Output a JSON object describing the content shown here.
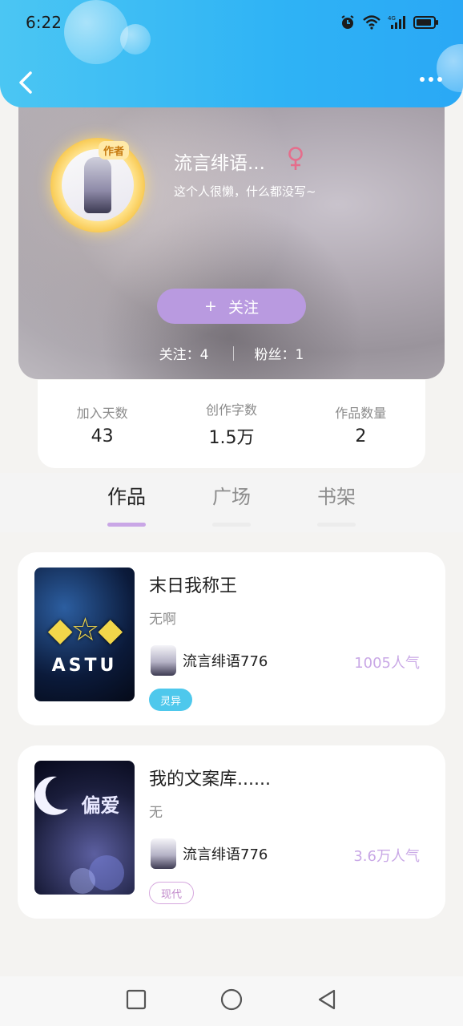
{
  "status_bar": {
    "time": "6:22",
    "network": "4G"
  },
  "header": {
    "back_icon": "chevron-left-icon",
    "more_icon": "more-dots-icon"
  },
  "profile": {
    "username": "流言绯语...",
    "gender_icon": "female-icon",
    "bio": "这个人很懒，什么都没写~",
    "avatar_badge": "作者",
    "follow_button": {
      "plus": "+",
      "label": "关注"
    },
    "following_label": "关注：",
    "following_count": "4",
    "fans_label": "粉丝：",
    "fans_count": "1"
  },
  "stats": [
    {
      "label": "加入天数",
      "value": "43"
    },
    {
      "label": "创作字数",
      "value": "1.5万"
    },
    {
      "label": "作品数量",
      "value": "2"
    }
  ],
  "tabs": [
    {
      "label": "作品",
      "active": true
    },
    {
      "label": "广场",
      "active": false
    },
    {
      "label": "书架",
      "active": false
    }
  ],
  "works": [
    {
      "title": "末日我称王",
      "description": "无啊",
      "author": "流言绯语776",
      "popularity": "1005人气",
      "tag": "灵异",
      "tag_style": "filled",
      "cover_text": "ASTU"
    },
    {
      "title": "我的文案库......",
      "description": "无",
      "author": "流言绯语776",
      "popularity": "3.6万人气",
      "tag": "现代",
      "tag_style": "outline",
      "cover_text": "偏爱"
    }
  ],
  "nav": {
    "recent_icon": "square-icon",
    "home_icon": "circle-icon",
    "back_icon": "triangle-back-icon"
  },
  "colors": {
    "header_blue": "#2fb3f5",
    "accent_purple": "#b99ae0",
    "tag_blue": "#4ec8ec",
    "popularity": "#c9a8e6"
  }
}
